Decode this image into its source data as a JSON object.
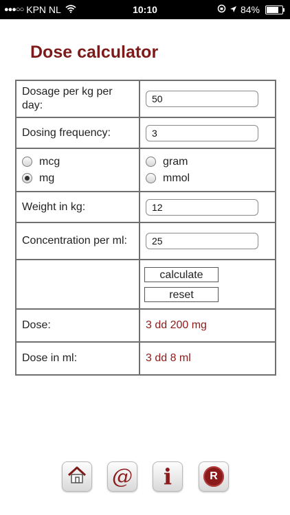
{
  "status_bar": {
    "carrier": "KPN NL",
    "time": "10:10",
    "battery": "84%",
    "battery_level": 0.84
  },
  "page": {
    "title": "Dose calculator"
  },
  "form": {
    "dosage_label": "Dosage per kg per day:",
    "dosage_value": "50",
    "frequency_label": "Dosing frequency:",
    "frequency_value": "3",
    "units": {
      "left": [
        {
          "label": "mcg",
          "selected": false
        },
        {
          "label": "mg",
          "selected": true
        }
      ],
      "right": [
        {
          "label": "gram",
          "selected": false
        },
        {
          "label": "mmol",
          "selected": false
        }
      ]
    },
    "weight_label": "Weight in kg:",
    "weight_value": "12",
    "concentration_label": "Concentration per ml:",
    "concentration_value": "25",
    "calculate_label": "calculate",
    "reset_label": "reset"
  },
  "results": {
    "dose_label": "Dose:",
    "dose_value": "3 dd 200 mg",
    "dose_ml_label": "Dose in ml:",
    "dose_ml_value": "3 dd 8 ml"
  },
  "toolbar": {
    "items": [
      {
        "icon": "home-icon"
      },
      {
        "icon": "at-icon",
        "glyph": "@"
      },
      {
        "icon": "info-icon",
        "glyph": "i"
      },
      {
        "icon": "r-logo-icon",
        "glyph": "R"
      }
    ]
  },
  "colors": {
    "accent": "#7d1a1a",
    "result_text": "#8b1a1a",
    "border": "#6f6f6f"
  }
}
